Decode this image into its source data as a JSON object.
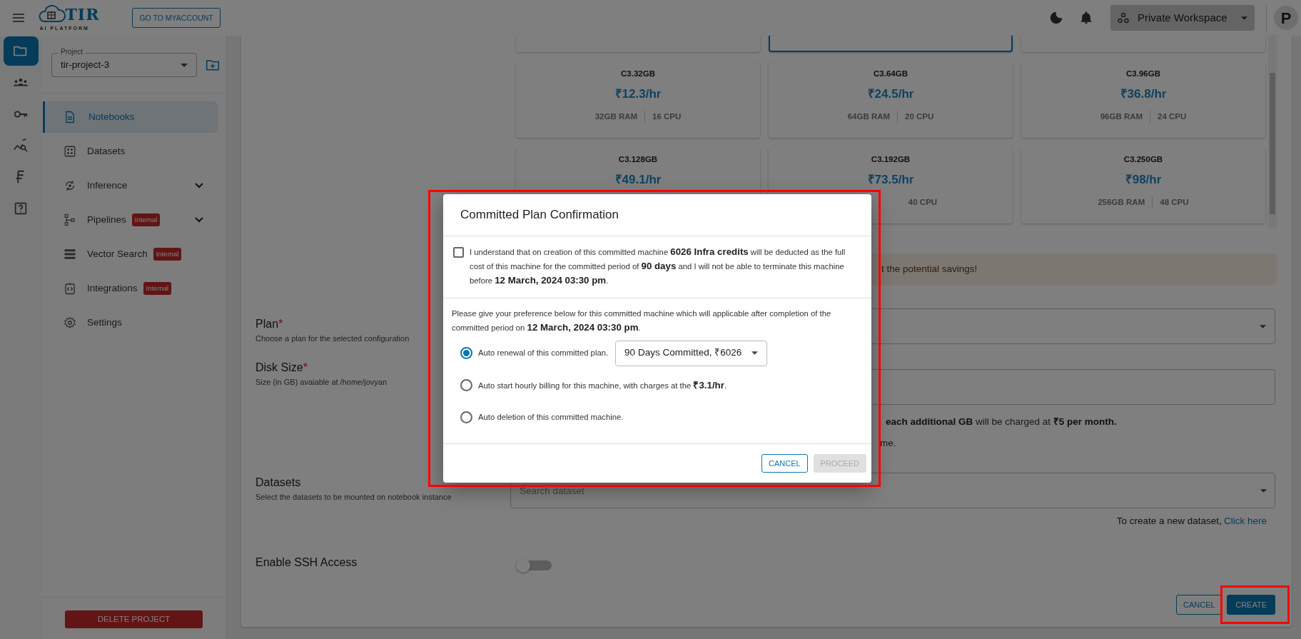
{
  "topbar": {
    "logo_title": "TIR",
    "logo_subtitle": "AI PLATFORM",
    "account_button": "GO TO MYACCOUNT",
    "workspace": "Private Workspace",
    "avatar": "P"
  },
  "rail": [
    {
      "selected": true
    },
    {
      "selected": false
    },
    {
      "selected": false
    },
    {
      "selected": false
    },
    {
      "selected": false
    },
    {
      "selected": false
    }
  ],
  "project": {
    "label": "Project",
    "value": "tir-project-3"
  },
  "nav": [
    {
      "label": "Notebooks",
      "selected": true,
      "expandable": false
    },
    {
      "label": "Datasets",
      "selected": false,
      "expandable": false
    },
    {
      "label": "Inference",
      "selected": false,
      "expandable": true
    },
    {
      "label": "Pipelines",
      "selected": false,
      "expandable": true,
      "badge": "Internal"
    },
    {
      "label": "Vector Search",
      "selected": false,
      "expandable": false,
      "badge": "Internal"
    },
    {
      "label": "Integrations",
      "selected": false,
      "expandable": false,
      "badge": "Internal"
    },
    {
      "label": "Settings",
      "selected": false,
      "expandable": false
    }
  ],
  "delete_button": "DELETE PROJECT",
  "plan_cards_cut": [
    {
      "selected": false
    },
    {
      "selected": true
    },
    {
      "selected": false
    }
  ],
  "plan_cards": [
    {
      "name": "C3.32GB",
      "price": "₹12.3/hr",
      "ram": "32GB RAM",
      "cpu": "16 CPU",
      "selected": false
    },
    {
      "name": "C3.64GB",
      "price": "₹24.5/hr",
      "ram": "64GB RAM",
      "cpu": "20 CPU",
      "selected": false
    },
    {
      "name": "C3.96GB",
      "price": "₹36.8/hr",
      "ram": "96GB RAM",
      "cpu": "24 CPU",
      "selected": false
    },
    {
      "name": "C3.128GB",
      "price": "₹49.1/hr",
      "selected": false
    },
    {
      "name": "C3.192GB",
      "price": "₹73.5/hr",
      "cpu": "40 CPU",
      "selected": false
    },
    {
      "name": "C3.250GB",
      "price": "₹98/hr",
      "ram": "256GB RAM",
      "cpu": "48 CPU",
      "selected": false
    }
  ],
  "banner": {
    "text": "t the potential savings!"
  },
  "form": {
    "plan": {
      "label": "Plan",
      "required_mark": "*",
      "hint": "Choose a plan for the selected configuration"
    },
    "disk": {
      "label": "Disk Size",
      "required_mark": "*",
      "hint": "Size (in GB) avaiable at /home/jovyan",
      "note": "**each additional GB** will be charged at **₹5 per month.**",
      "note_tail": "me."
    },
    "datasets": {
      "label": "Datasets",
      "hint": "Select the datasets to be mounted on notebook instance",
      "placeholder": "Search dataset",
      "create_text": "To create a new dataset,",
      "create_link": "Click here"
    },
    "ssh": {
      "label": "Enable SSH Access",
      "on": false
    },
    "cancel": "CANCEL",
    "create": "CREATE"
  },
  "modal": {
    "title": "Committed Plan Confirmation",
    "agree": {
      "checked": false,
      "text": "I understand that on creation of this committed machine **6026 Infra credits** will be deducted as the full cost of this machine for the committed period of **90 days** and I will not be able to terminate this machine before **12 March, 2024 03:30 pm**."
    },
    "preference_text": "Please give your preference below for this committed machine which will applicable after completion of the committed period on **12 March, 2024 03:30 pm**.",
    "options": [
      {
        "text": "Auto renewal of this committed plan.",
        "selected": true,
        "select_value": "90 Days Committed, ₹6026"
      },
      {
        "text": "Auto start hourly billing for this machine, with charges at the **₹3.1/hr**.",
        "selected": false
      },
      {
        "text": "Auto deletion of this committed machine.",
        "selected": false
      }
    ],
    "cancel": "CANCEL",
    "proceed": "PROCEED",
    "proceed_disabled": true
  }
}
